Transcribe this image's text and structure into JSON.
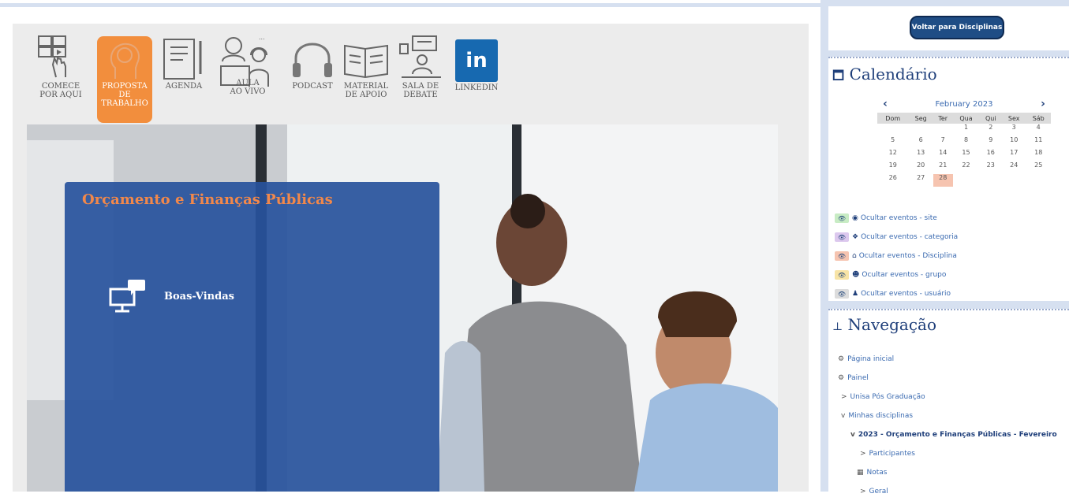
{
  "toolbar": {
    "items": [
      {
        "label": "COMECE\nPOR AQUI"
      },
      {
        "label": "PROPOSTA\nDE\nTRABALHO"
      },
      {
        "label": "AGENDA"
      },
      {
        "label": "AULA\nAO VIVO"
      },
      {
        "label": "PODCAST"
      },
      {
        "label": "MATERIAL\nDE APOIO"
      },
      {
        "label": "SALA DE\nDEBATE"
      },
      {
        "label": "LINKEDIN"
      }
    ],
    "linkedin_glyph": "in",
    "active_color": "#f28e3d"
  },
  "course": {
    "title": "Orçamento e Finanças Públicas",
    "welcome_label": "Boas-Vindas"
  },
  "sidebar": {
    "back_button": "Voltar para Disciplinas",
    "calendar": {
      "title": "Calendário",
      "month": "February 2023",
      "weekdays": [
        "Dom",
        "Seg",
        "Ter",
        "Qua",
        "Qui",
        "Sex",
        "Sáb"
      ],
      "weeks": [
        [
          "",
          "",
          "",
          "1",
          "2",
          "3",
          "4"
        ],
        [
          "5",
          "6",
          "7",
          "8",
          "9",
          "10",
          "11"
        ],
        [
          "12",
          "13",
          "14",
          "15",
          "16",
          "17",
          "18"
        ],
        [
          "19",
          "20",
          "21",
          "22",
          "23",
          "24",
          "25"
        ],
        [
          "26",
          "27",
          "28",
          "",
          "",
          "",
          ""
        ]
      ],
      "today": "28",
      "events": [
        {
          "label": "Ocultar eventos - site",
          "color": "#c8ecc4",
          "icon": "globe-icon"
        },
        {
          "label": "Ocultar eventos - categoria",
          "color": "#dcc8ee",
          "icon": "categories-icon"
        },
        {
          "label": "Ocultar eventos - Disciplina",
          "color": "#f6c4b0",
          "icon": "graduation-cap-icon"
        },
        {
          "label": "Ocultar eventos - grupo",
          "color": "#f8e4a6",
          "icon": "group-icon"
        },
        {
          "label": "Ocultar eventos - usuário",
          "color": "#dcdcdc",
          "icon": "user-icon"
        }
      ]
    },
    "navigation": {
      "title": "Navegação",
      "items": [
        {
          "label": "Página inicial",
          "prefix": "⚙",
          "indent": 0
        },
        {
          "label": "Painel",
          "prefix": "⚙",
          "indent": 0
        },
        {
          "label": "Unisa Pós Graduação",
          "prefix": ">",
          "indent": 1
        },
        {
          "label": "Minhas disciplinas",
          "prefix": "v",
          "indent": 1
        },
        {
          "label": "2023 - Orçamento e Finanças Públicas - Fevereiro",
          "prefix": "v",
          "indent": 2
        },
        {
          "label": "Participantes",
          "prefix": ">",
          "indent": 3
        },
        {
          "label": "Notas",
          "prefix": "▦",
          "indent": 2
        },
        {
          "label": "Geral",
          "prefix": ">",
          "indent": 3
        }
      ]
    }
  }
}
